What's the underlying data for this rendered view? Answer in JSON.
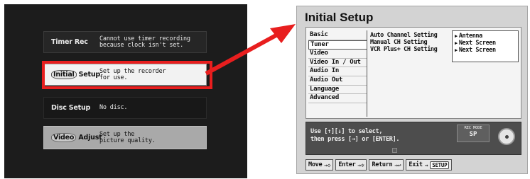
{
  "main_menu": {
    "items": [
      {
        "label": "Timer Rec",
        "description": "Cannot use timer recording\nbecause clock isn't set."
      },
      {
        "label_pre": "Initial",
        "label_post": "Setup",
        "description": "Set up the recorder\nfor use."
      },
      {
        "label": "Disc Setup",
        "description": "No disc."
      },
      {
        "label_pre": "Video",
        "label_post": "Adjust",
        "description": "Set up the\npicture quality."
      }
    ],
    "highlight_color": "#e81e1e"
  },
  "initial_setup": {
    "title": "Initial Setup",
    "tabs": [
      "Basic",
      "Tuner",
      "Video",
      "Video In / Out",
      "Audio In",
      "Audio Out",
      "Language",
      "Advanced"
    ],
    "active_tab": "Tuner",
    "settings": [
      "Auto Channel Setting",
      "Manual CH Setting",
      "VCR Plus+ CH Setting"
    ],
    "values": [
      "Antenna",
      "Next Screen",
      "Next Screen"
    ],
    "help_text": "Use [↑][↓] to select,\nthen press [→] or [ENTER].",
    "rec_mode": {
      "label": "REC MODE",
      "value": "SP"
    },
    "nav": {
      "move": "Move",
      "enter": "Enter",
      "return": "Return",
      "exit": "Exit",
      "setup_key": "SETUP"
    }
  }
}
